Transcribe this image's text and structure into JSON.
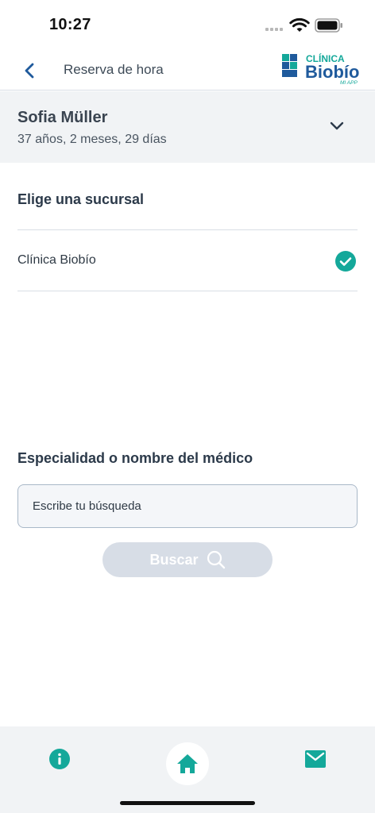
{
  "status_bar": {
    "time": "10:27"
  },
  "header": {
    "title": "Reserva de hora",
    "logo": {
      "line1": "CLÍNICA",
      "line2": "Biobío",
      "line3": "MI APP"
    }
  },
  "patient": {
    "name": "Sofia Müller",
    "age": "37 años, 2 meses, 29 días"
  },
  "branch_section": {
    "title": "Elige una sucursal",
    "items": [
      {
        "label": "Clínica Biobío",
        "selected": true
      }
    ]
  },
  "search_section": {
    "title": "Especialidad o nombre del médico",
    "input_value": "",
    "placeholder": "Escribe tu búsqueda",
    "button_label": "Buscar"
  },
  "bottom_nav": {
    "items": [
      "info-icon",
      "home-icon",
      "mail-icon"
    ]
  },
  "colors": {
    "accent": "#14a89a",
    "brand_blue": "#1f5a9c",
    "text": "#2f3a45"
  }
}
